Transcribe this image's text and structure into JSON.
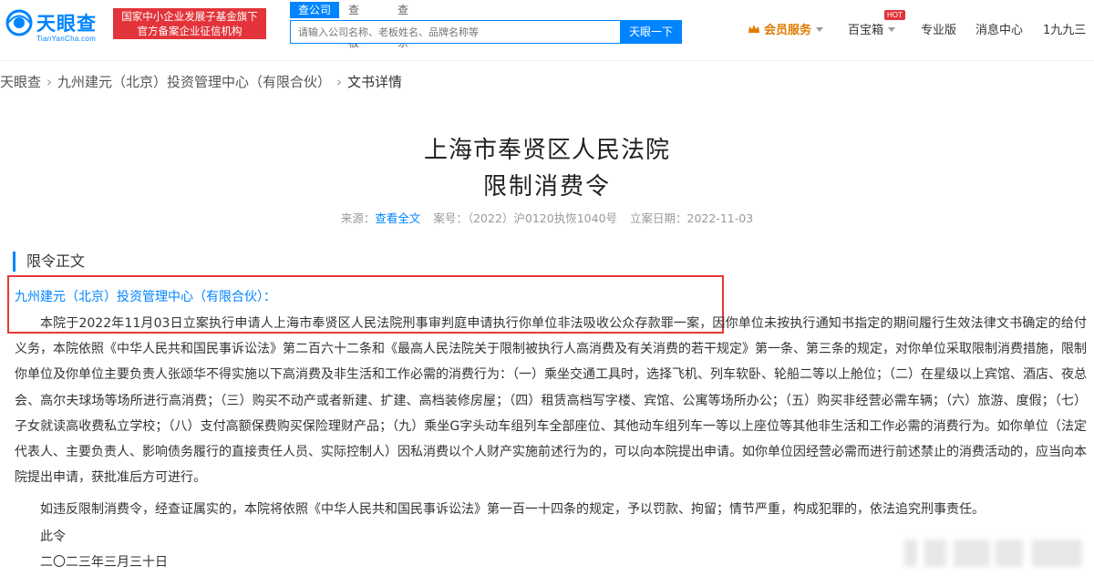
{
  "header": {
    "logo_name": "天眼查",
    "logo_sub": "TianYanCha.com",
    "banner_line1": "国家中小企业发展子基金旗下",
    "banner_line2": "官方备案企业征信机构",
    "tabs": [
      "查公司",
      "查老板",
      "查关系"
    ],
    "search_placeholder": "请输入公司名称、老板姓名、品牌名称等",
    "search_button": "天眼一下",
    "vip_label": "会员服务",
    "baibaoxiang": "百宝箱",
    "hot_badge": "HOT",
    "pro": "专业版",
    "messages": "消息中心",
    "user": "1九九三"
  },
  "breadcrumb": [
    "天眼查",
    "九州建元（北京）投资管理中心（有限合伙）",
    "文书详情"
  ],
  "document": {
    "court": "上海市奉贤区人民法院",
    "title": "限制消费令",
    "source_label": "来源：",
    "source_link": "查看全文",
    "case_no": "案号：（2022）沪0120执恢1040号",
    "filing_date": "立案日期：2022-11-03",
    "section_title": "限令正文",
    "party": "九州建元（北京）投资管理中心（有限合伙）：",
    "body": "本院于2022年11月03日立案执行申请人上海市奉贤区人民法院刑事审判庭申请执行你单位非法吸收公众存款罪一案，因你单位未按执行通知书指定的期间履行生效法律文书确定的给付义务，本院依照《中华人民共和国民事诉讼法》第二百六十二条和《最高人民法院关于限制被执行人高消费及有关消费的若干规定》第一条、第三条的规定，对你单位采取限制消费措施，限制你单位及你单位主要负责人张颂华不得实施以下高消费及非生活和工作必需的消费行为：（一）乘坐交通工具时，选择飞机、列车软卧、轮船二等以上舱位；（二）在星级以上宾馆、酒店、夜总会、高尔夫球场等场所进行高消费；（三）购买不动产或者新建、扩建、高档装修房屋；（四）租赁高档写字楼、宾馆、公寓等场所办公；（五）购买非经营必需车辆；（六）旅游、度假；（七）子女就读高收费私立学校；（八）支付高额保费购买保险理财产品；（九）乘坐G字头动车组列车全部座位、其他动车组列车一等以上座位等其他非生活和工作必需的消费行为。如你单位（法定代表人、主要负责人、影响债务履行的直接责任人员、实际控制人）因私消费以个人财产实施前述行为的，可以向本院提出申请。如你单位因经营必需而进行前述禁止的消费活动的，应当向本院提出申请，获批准后方可进行。",
    "warning": "如违反限制消费令，经查证属实的，本院将依照《中华人民共和国民事诉讼法》第一百一十四条的规定，予以罚款、拘留；情节严重，构成犯罪的，依法追究刑事责任。",
    "closing": "此令",
    "date": "二〇二三年三月三十日"
  },
  "colors": {
    "brand_blue": "#0084ff",
    "banner_red": "#e2343a",
    "highlight_red": "#e53935",
    "vip_orange": "#e17a00"
  }
}
